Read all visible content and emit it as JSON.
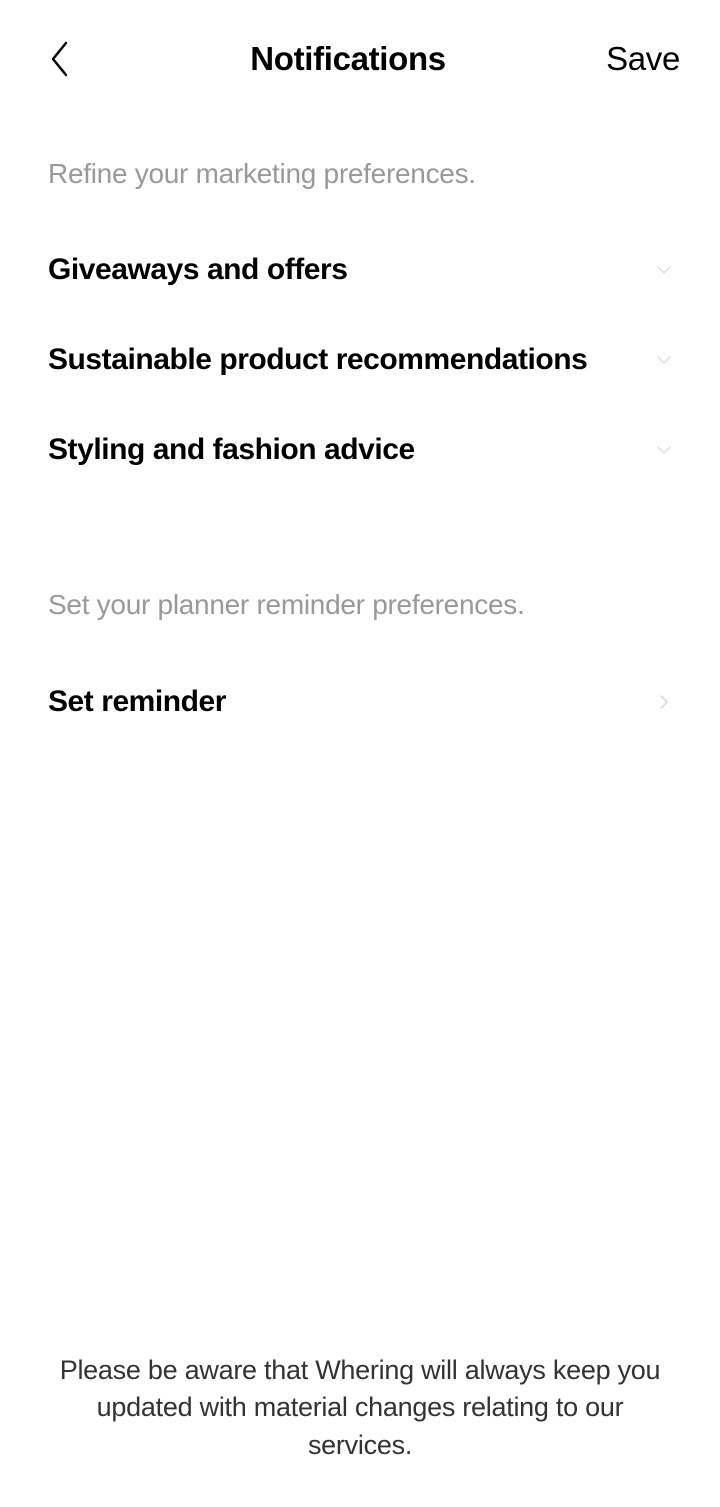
{
  "header": {
    "title": "Notifications",
    "save_label": "Save"
  },
  "sections": {
    "marketing": {
      "header": "Refine your marketing preferences.",
      "items": [
        {
          "label": "Giveaways and offers"
        },
        {
          "label": "Sustainable product recommendations"
        },
        {
          "label": "Styling and fashion advice"
        }
      ]
    },
    "planner": {
      "header": "Set your planner reminder preferences.",
      "set_reminder_label": "Set reminder"
    }
  },
  "footer": {
    "notice": "Please be aware that Whering will always keep you updated with material changes relating to our services."
  }
}
